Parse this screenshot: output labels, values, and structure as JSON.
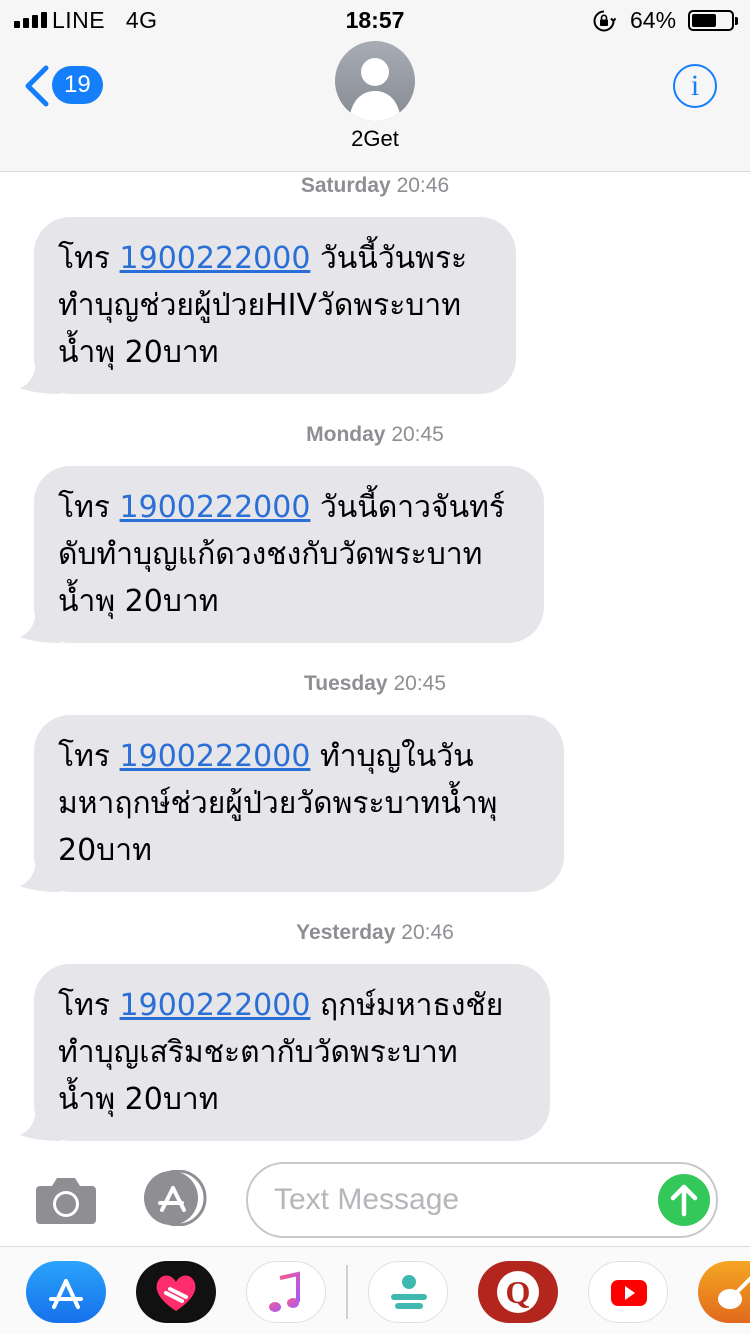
{
  "status_bar": {
    "carrier": "LINE",
    "network": "4G",
    "time": "18:57",
    "battery_percent": "64%",
    "battery_level": 0.64,
    "orientation_lock_icon": "orientation-lock-icon",
    "signal_icon": "signal-bars-icon"
  },
  "header": {
    "back_count": "19",
    "contact_name": "2Get",
    "info_label": "i",
    "avatar_icon": "person-silhouette-icon"
  },
  "messages": [
    {
      "day": "Saturday",
      "time": "20:46",
      "prefix": "โทร ",
      "phone": "1900222000",
      "line1": " วันนี้วันพระ",
      "line2": "ทำบุญช่วยผู้ป่วยHIVวัดพระบาท",
      "line3": "น้ำพุ 20บาท"
    },
    {
      "day": "Monday",
      "time": "20:45",
      "prefix": "โทร ",
      "phone": "1900222000",
      "line1": " วันนี้ดาวจันทร์",
      "line2": "ดับทำบุญแก้ดวงชงกับวัดพระบาท",
      "line3": "น้ำพุ 20บาท"
    },
    {
      "day": "Tuesday",
      "time": "20:45",
      "prefix": "โทร ",
      "phone": "1900222000",
      "line1": " ทำบุญในวัน",
      "line2": "มหาฤกษ์ช่วยผู้ป่วยวัดพระบาทน้ำพุ",
      "line3": "20บาท"
    },
    {
      "day": "Yesterday",
      "time": "20:46",
      "prefix": "โทร ",
      "phone": "1900222000",
      "line1": " ฤกษ์มหาธงชัย",
      "line2": "ทำบุญเสริมชะตากับวัดพระบาท",
      "line3": "น้ำพุ 20บาท"
    }
  ],
  "composer": {
    "placeholder": "Text Message",
    "camera_icon": "camera-icon",
    "apps_icon": "app-store-icon",
    "send_icon": "send-arrow-icon"
  },
  "app_drawer": [
    {
      "name": "App Store",
      "icon": "app-store-icon",
      "color": "#1b8cf8"
    },
    {
      "name": "Digital Touch",
      "icon": "heart-hands-icon",
      "color": "#111111"
    },
    {
      "name": "Music",
      "icon": "music-note-icon",
      "color": "#ffffff"
    },
    {
      "name": "Memoji",
      "icon": "memoji-icon",
      "color": "#ffffff"
    },
    {
      "name": "Q app",
      "icon": "q-icon",
      "color": "#b3261e"
    },
    {
      "name": "YouTube",
      "icon": "youtube-play-icon",
      "color": "#ffffff"
    },
    {
      "name": "GarageBand",
      "icon": "guitar-icon",
      "color": "#f08a24"
    }
  ],
  "colors": {
    "accent": "#147efb",
    "link": "#2a6fd6",
    "bubble": "#e5e5ea",
    "send": "#34c759",
    "timestamp": "#8e8e93"
  }
}
